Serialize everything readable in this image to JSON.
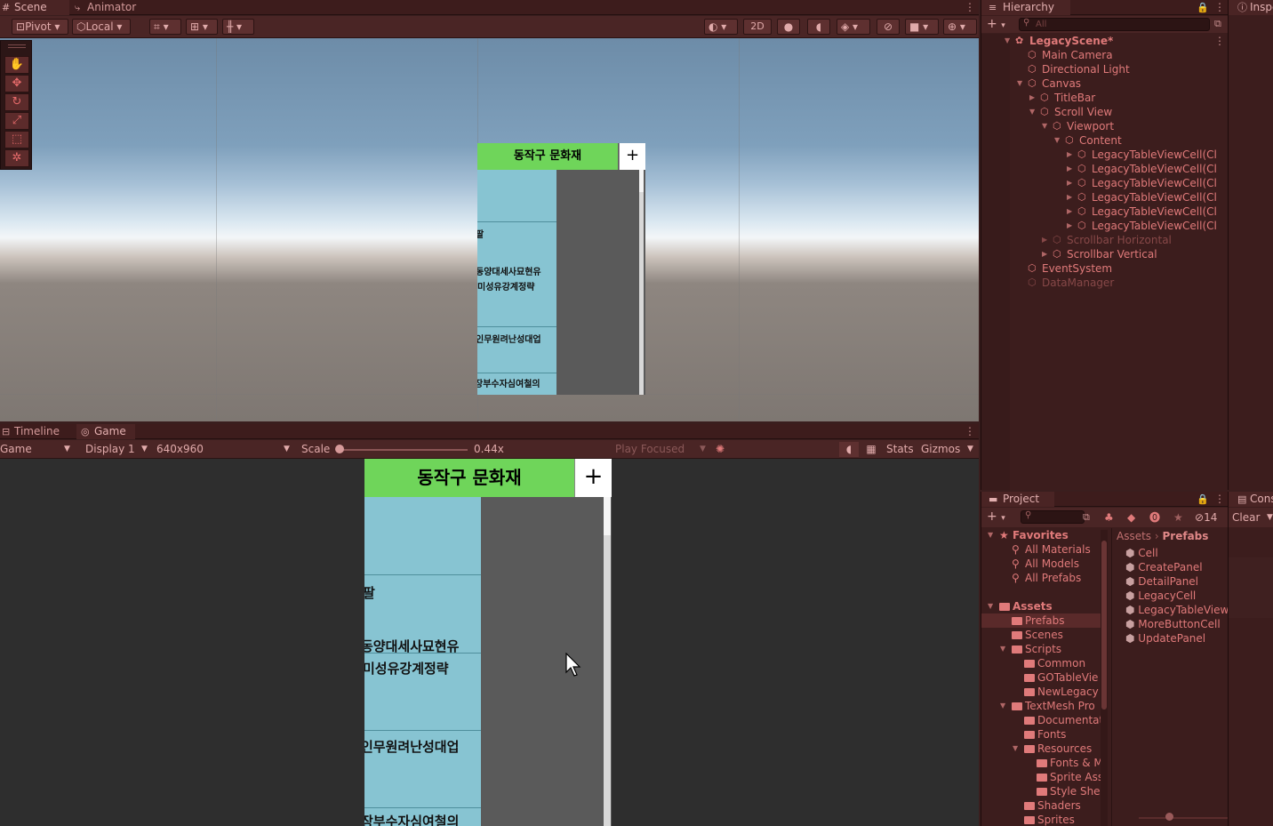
{
  "scene_window": {
    "tabs": [
      {
        "label": "Scene",
        "icon": "grid-icon"
      },
      {
        "label": "Animator",
        "icon": "animator-icon"
      }
    ],
    "toolbar": {
      "pivot": "Pivot",
      "local": "Local",
      "mode_2d": "2D"
    }
  },
  "scene_ui": {
    "title": "동작구 문화재",
    "plus": "+",
    "cells": [
      "",
      "팔",
      "동양대세사묘현유",
      "미성유강계정략",
      "인무원려난성대업",
      "장부수자심여철의"
    ]
  },
  "game_window": {
    "tabs": [
      {
        "label": "Timeline",
        "icon": "timeline-icon"
      },
      {
        "label": "Game",
        "icon": "gamepad-icon"
      }
    ],
    "toolbar": {
      "game": "Game",
      "display": "Display 1",
      "resolution": "640x960",
      "scale_label": "Scale",
      "scale_value": "0.44x",
      "play_mode": "Play Focused",
      "stats": "Stats",
      "gizmos": "Gizmos"
    }
  },
  "hierarchy": {
    "tab": "Hierarchy",
    "search_placeholder": "All",
    "items": [
      {
        "label": "LegacyScene*",
        "depth": 0,
        "arrow": "down",
        "bold": true
      },
      {
        "label": "Main Camera",
        "depth": 1,
        "arrow": "none"
      },
      {
        "label": "Directional Light",
        "depth": 1,
        "arrow": "none"
      },
      {
        "label": "Canvas",
        "depth": 1,
        "arrow": "down"
      },
      {
        "label": "TitleBar",
        "depth": 2,
        "arrow": "right"
      },
      {
        "label": "Scroll View",
        "depth": 2,
        "arrow": "down"
      },
      {
        "label": "Viewport",
        "depth": 3,
        "arrow": "down"
      },
      {
        "label": "Content",
        "depth": 4,
        "arrow": "down"
      },
      {
        "label": "LegacyTableViewCell(Cl",
        "depth": 5,
        "arrow": "right"
      },
      {
        "label": "LegacyTableViewCell(Cl",
        "depth": 5,
        "arrow": "right"
      },
      {
        "label": "LegacyTableViewCell(Cl",
        "depth": 5,
        "arrow": "right"
      },
      {
        "label": "LegacyTableViewCell(Cl",
        "depth": 5,
        "arrow": "right"
      },
      {
        "label": "LegacyTableViewCell(Cl",
        "depth": 5,
        "arrow": "right"
      },
      {
        "label": "LegacyTableViewCell(Cl",
        "depth": 5,
        "arrow": "right"
      },
      {
        "label": "Scrollbar Horizontal",
        "depth": 3,
        "arrow": "right",
        "dim": true
      },
      {
        "label": "Scrollbar Vertical",
        "depth": 3,
        "arrow": "right"
      },
      {
        "label": "EventSystem",
        "depth": 1,
        "arrow": "none"
      },
      {
        "label": "DataManager",
        "depth": 1,
        "arrow": "none",
        "dim": true
      }
    ]
  },
  "inspector": {
    "tab": "Inspe"
  },
  "console": {
    "tab": "Cons",
    "clear": "Clear"
  },
  "project": {
    "tab": "Project",
    "hidden_count": "14",
    "breadcrumb": [
      "Assets",
      "Prefabs"
    ],
    "tree": [
      {
        "label": "Favorites",
        "depth": 0,
        "kind": "star",
        "arrow": "down",
        "bold": true
      },
      {
        "label": "All Materials",
        "depth": 1,
        "kind": "search"
      },
      {
        "label": "All Models",
        "depth": 1,
        "kind": "search"
      },
      {
        "label": "All Prefabs",
        "depth": 1,
        "kind": "search"
      },
      {
        "label": "",
        "depth": 0,
        "kind": "spacer"
      },
      {
        "label": "Assets",
        "depth": 0,
        "kind": "folder",
        "arrow": "down",
        "bold": true
      },
      {
        "label": "Prefabs",
        "depth": 1,
        "kind": "folder",
        "selected": true
      },
      {
        "label": "Scenes",
        "depth": 1,
        "kind": "folder"
      },
      {
        "label": "Scripts",
        "depth": 1,
        "kind": "folder",
        "arrow": "down"
      },
      {
        "label": "Common",
        "depth": 2,
        "kind": "folder"
      },
      {
        "label": "GOTableVie",
        "depth": 2,
        "kind": "folder"
      },
      {
        "label": "NewLegacy",
        "depth": 2,
        "kind": "folder"
      },
      {
        "label": "TextMesh Pro",
        "depth": 1,
        "kind": "folder",
        "arrow": "down"
      },
      {
        "label": "Documentat",
        "depth": 2,
        "kind": "folder"
      },
      {
        "label": "Fonts",
        "depth": 2,
        "kind": "folder"
      },
      {
        "label": "Resources",
        "depth": 2,
        "kind": "folder",
        "arrow": "down"
      },
      {
        "label": "Fonts & M",
        "depth": 3,
        "kind": "folder"
      },
      {
        "label": "Sprite Ass",
        "depth": 3,
        "kind": "folder"
      },
      {
        "label": "Style Shee",
        "depth": 3,
        "kind": "folder"
      },
      {
        "label": "Shaders",
        "depth": 2,
        "kind": "folder"
      },
      {
        "label": "Sprites",
        "depth": 2,
        "kind": "folder"
      }
    ],
    "assets": [
      "Cell",
      "CreatePanel",
      "DetailPanel",
      "LegacyCell",
      "LegacyTableView",
      "MoreButtonCell",
      "UpdatePanel"
    ]
  },
  "colors": {
    "accent": "#e07a7a",
    "title_bar": "#6fd55a",
    "cell": "#87c4d2",
    "panel_bg": "#5a5a5a"
  }
}
